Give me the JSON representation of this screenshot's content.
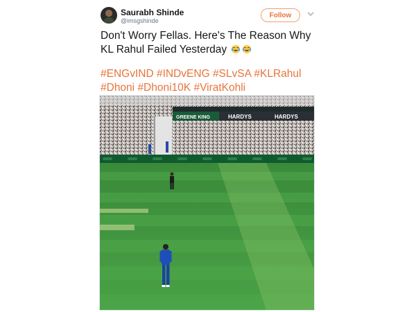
{
  "tweet": {
    "author_name": "Saurabh Shinde",
    "author_handle": "@imsgshinde",
    "follow_label": "Follow",
    "text": "Don't Worry Fellas. Here's The Reason Why KL Rahul Failed Yesterday",
    "hashtags": [
      "#ENGvIND",
      "#INDvENG",
      "#SLvSA",
      "#KLRahul",
      "#Dhoni",
      "#Dhoni10K",
      "#ViratKohli"
    ],
    "emojis": [
      "face-with-tears-of-joy-icon",
      "face-with-tears-of-joy-icon"
    ]
  },
  "media": {
    "stand_banner_left": "GREENE KING",
    "stand_banner_right_1": "HARDYS",
    "stand_banner_right_2": "HARDYS"
  },
  "colors": {
    "link": "#e8743b",
    "text": "#14171a",
    "muted": "#657786",
    "pitch": "#3c8f3c"
  }
}
